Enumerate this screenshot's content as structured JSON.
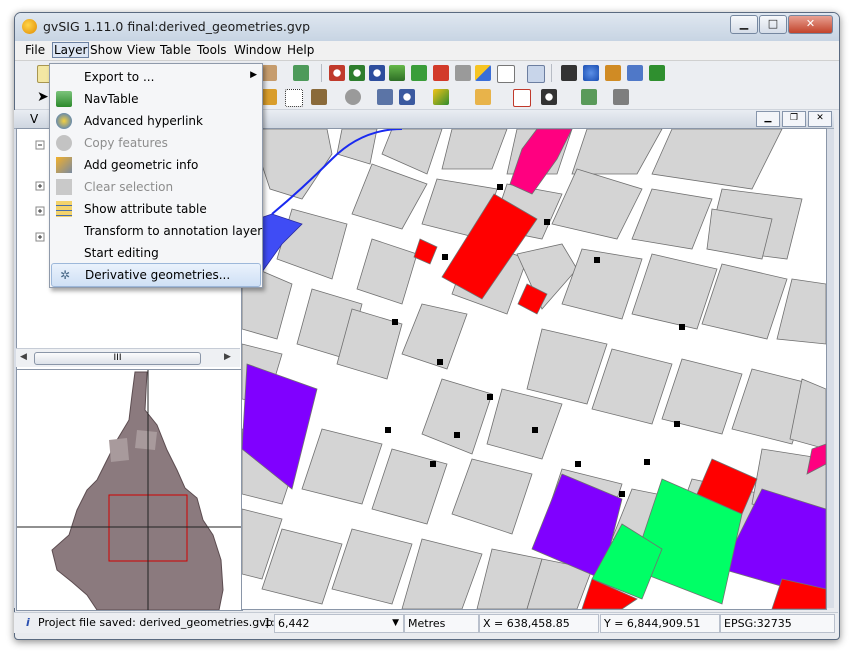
{
  "window": {
    "title": "gvSIG 1.11.0 final:derived_geometries.gvp",
    "app_icon": "gvsig-icon",
    "controls": [
      "minimize-icon",
      "maximize-icon",
      "close-icon"
    ]
  },
  "menubar": {
    "items": [
      "File",
      "Layer",
      "Show",
      "View",
      "Table",
      "Tools",
      "Window",
      "Help"
    ],
    "active": "Layer"
  },
  "layer_menu": {
    "items": [
      {
        "label": "Export to ...",
        "icon": "none",
        "enabled": true,
        "submenu": true
      },
      {
        "label": "NavTable",
        "icon": "navtable-icon",
        "enabled": true
      },
      {
        "label": "Advanced hyperlink",
        "icon": "hyperlink-icon",
        "enabled": true
      },
      {
        "label": "Copy features",
        "icon": "copy-features-icon",
        "enabled": false
      },
      {
        "label": "Add geometric info",
        "icon": "geometric-info-icon",
        "enabled": true
      },
      {
        "label": "Clear selection",
        "icon": "clear-selection-icon",
        "enabled": false
      },
      {
        "label": "Show attribute table",
        "icon": "attribute-table-icon",
        "enabled": true
      },
      {
        "label": "Transform to annotation layer",
        "icon": "none",
        "enabled": true
      },
      {
        "label": "Start editing",
        "icon": "none",
        "enabled": true
      },
      {
        "label": "Derivative geometries...",
        "icon": "derivative-geometries-icon",
        "enabled": true,
        "highlighted": true
      }
    ]
  },
  "view_window": {
    "title_fragment": "V",
    "controls": [
      "minimize-icon",
      "restore-icon",
      "close-icon"
    ]
  },
  "toc": {
    "scrollbar_grip": "III"
  },
  "statusbar": {
    "message": "Project file saved: derived_geometries.gvp",
    "scale_prefix": "1:",
    "scale": "6,442",
    "units": "Metres",
    "x": "X = 638,458.85",
    "y": "Y = 6,844,909.51",
    "crs": "EPSG:32735"
  },
  "colors": {
    "parcel_fill": "#d4d4d4",
    "parcel_stroke": "#707070",
    "highlight_red": "#ff0000",
    "highlight_magenta": "#ff0080",
    "highlight_purple": "#8000ff",
    "highlight_green": "#00ff66",
    "water_blue": "#3f4cf5"
  }
}
